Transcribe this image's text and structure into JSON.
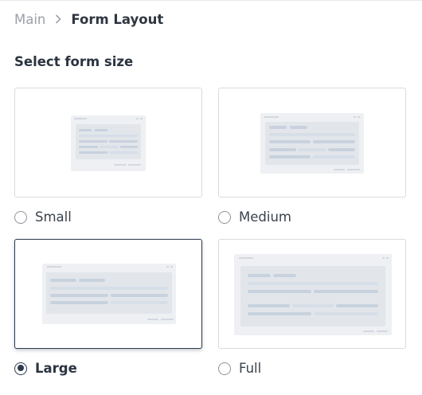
{
  "breadcrumb": {
    "parent": "Main",
    "current": "Form Layout"
  },
  "section_title": "Select form size",
  "options": [
    {
      "label": "Small",
      "checked": false
    },
    {
      "label": "Medium",
      "checked": false
    },
    {
      "label": "Large",
      "checked": true
    },
    {
      "label": "Full",
      "checked": false
    }
  ],
  "colors": {
    "accent": "#2c3a4d",
    "card_border": "#d7dbe0",
    "illus_frame": "#eef0f3",
    "illus_panel": "#e4e7ec",
    "illus_bar_dark": "#c8d2de",
    "illus_bar_light": "#d6dee8"
  },
  "icons": {
    "breadcrumb_separator": "chevron-right-icon"
  }
}
